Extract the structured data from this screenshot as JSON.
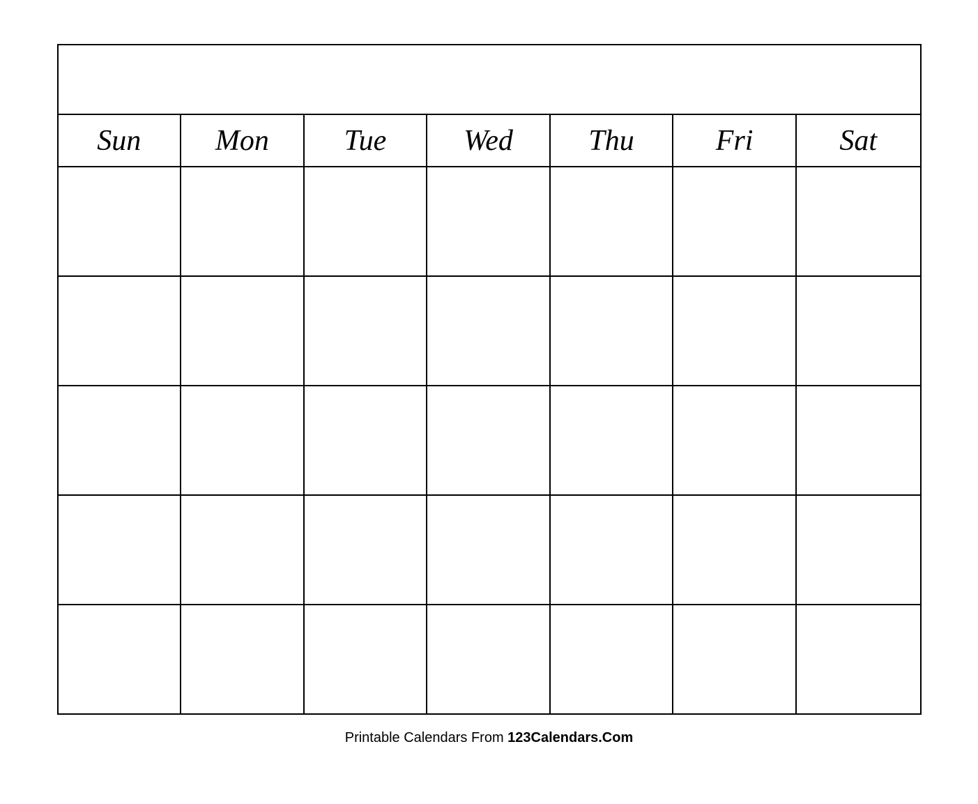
{
  "calendar": {
    "title": "",
    "days": [
      "Sun",
      "Mon",
      "Tue",
      "Wed",
      "Thu",
      "Fri",
      "Sat"
    ],
    "rows": 5
  },
  "footer": {
    "text_normal": "Printable Calendars From ",
    "text_bold": "123Calendars.Com"
  }
}
